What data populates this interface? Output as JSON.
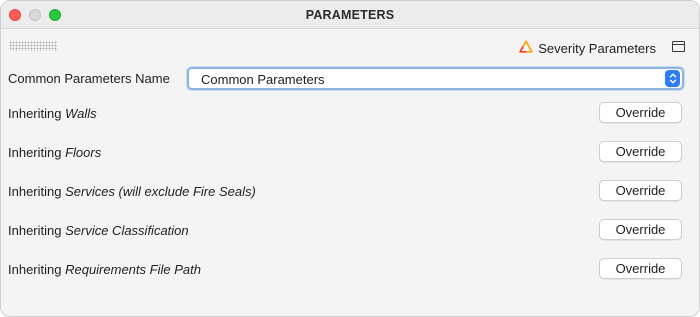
{
  "window": {
    "title": "PARAMETERS"
  },
  "toolbar": {
    "severity_parameters_label": "Severity Parameters",
    "severity_icon": "warning-triangle-icon",
    "panel_icon": "sidebar-panel-icon"
  },
  "common_parameters": {
    "label": "Common Parameters Name",
    "selected_value": "Common Parameters",
    "accent_color": "#2f7df6"
  },
  "rows": [
    {
      "prefix": "Inheriting ",
      "name": "Walls",
      "button": "Override"
    },
    {
      "prefix": "Inheriting ",
      "name": "Floors",
      "button": "Override"
    },
    {
      "prefix": "Inheriting ",
      "name": "Services (will exclude Fire Seals)",
      "button": "Override"
    },
    {
      "prefix": "Inheriting ",
      "name": "Service Classification",
      "button": "Override"
    },
    {
      "prefix": "Inheriting ",
      "name": "Requirements File Path",
      "button": "Override"
    }
  ]
}
